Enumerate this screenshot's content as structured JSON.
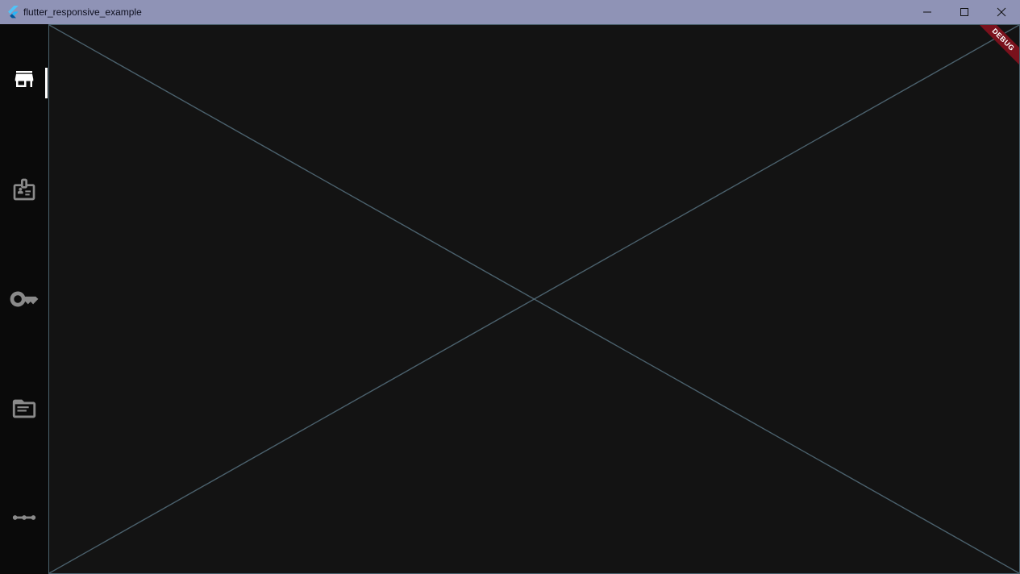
{
  "window": {
    "title": "flutter_responsive_example",
    "controls": {
      "minimize": "minimize-icon",
      "maximize": "maximize-icon",
      "close": "close-icon"
    },
    "titlebar_color": "#8f93b6"
  },
  "nav_rail": {
    "items": [
      {
        "name": "store",
        "icon": "store-icon",
        "selected": true
      },
      {
        "name": "badge",
        "icon": "badge-icon",
        "selected": false
      },
      {
        "name": "key",
        "icon": "key-icon",
        "selected": false
      },
      {
        "name": "document",
        "icon": "document-icon",
        "selected": false
      },
      {
        "name": "more",
        "icon": "more-icon",
        "selected": false
      }
    ],
    "selected_color": "#ffffff",
    "unselected_color": "#8a8a8a"
  },
  "content": {
    "type": "placeholder",
    "line_color": "#4b616d"
  },
  "debug_banner": {
    "label": "DEBUG",
    "color": "#7a111c"
  }
}
